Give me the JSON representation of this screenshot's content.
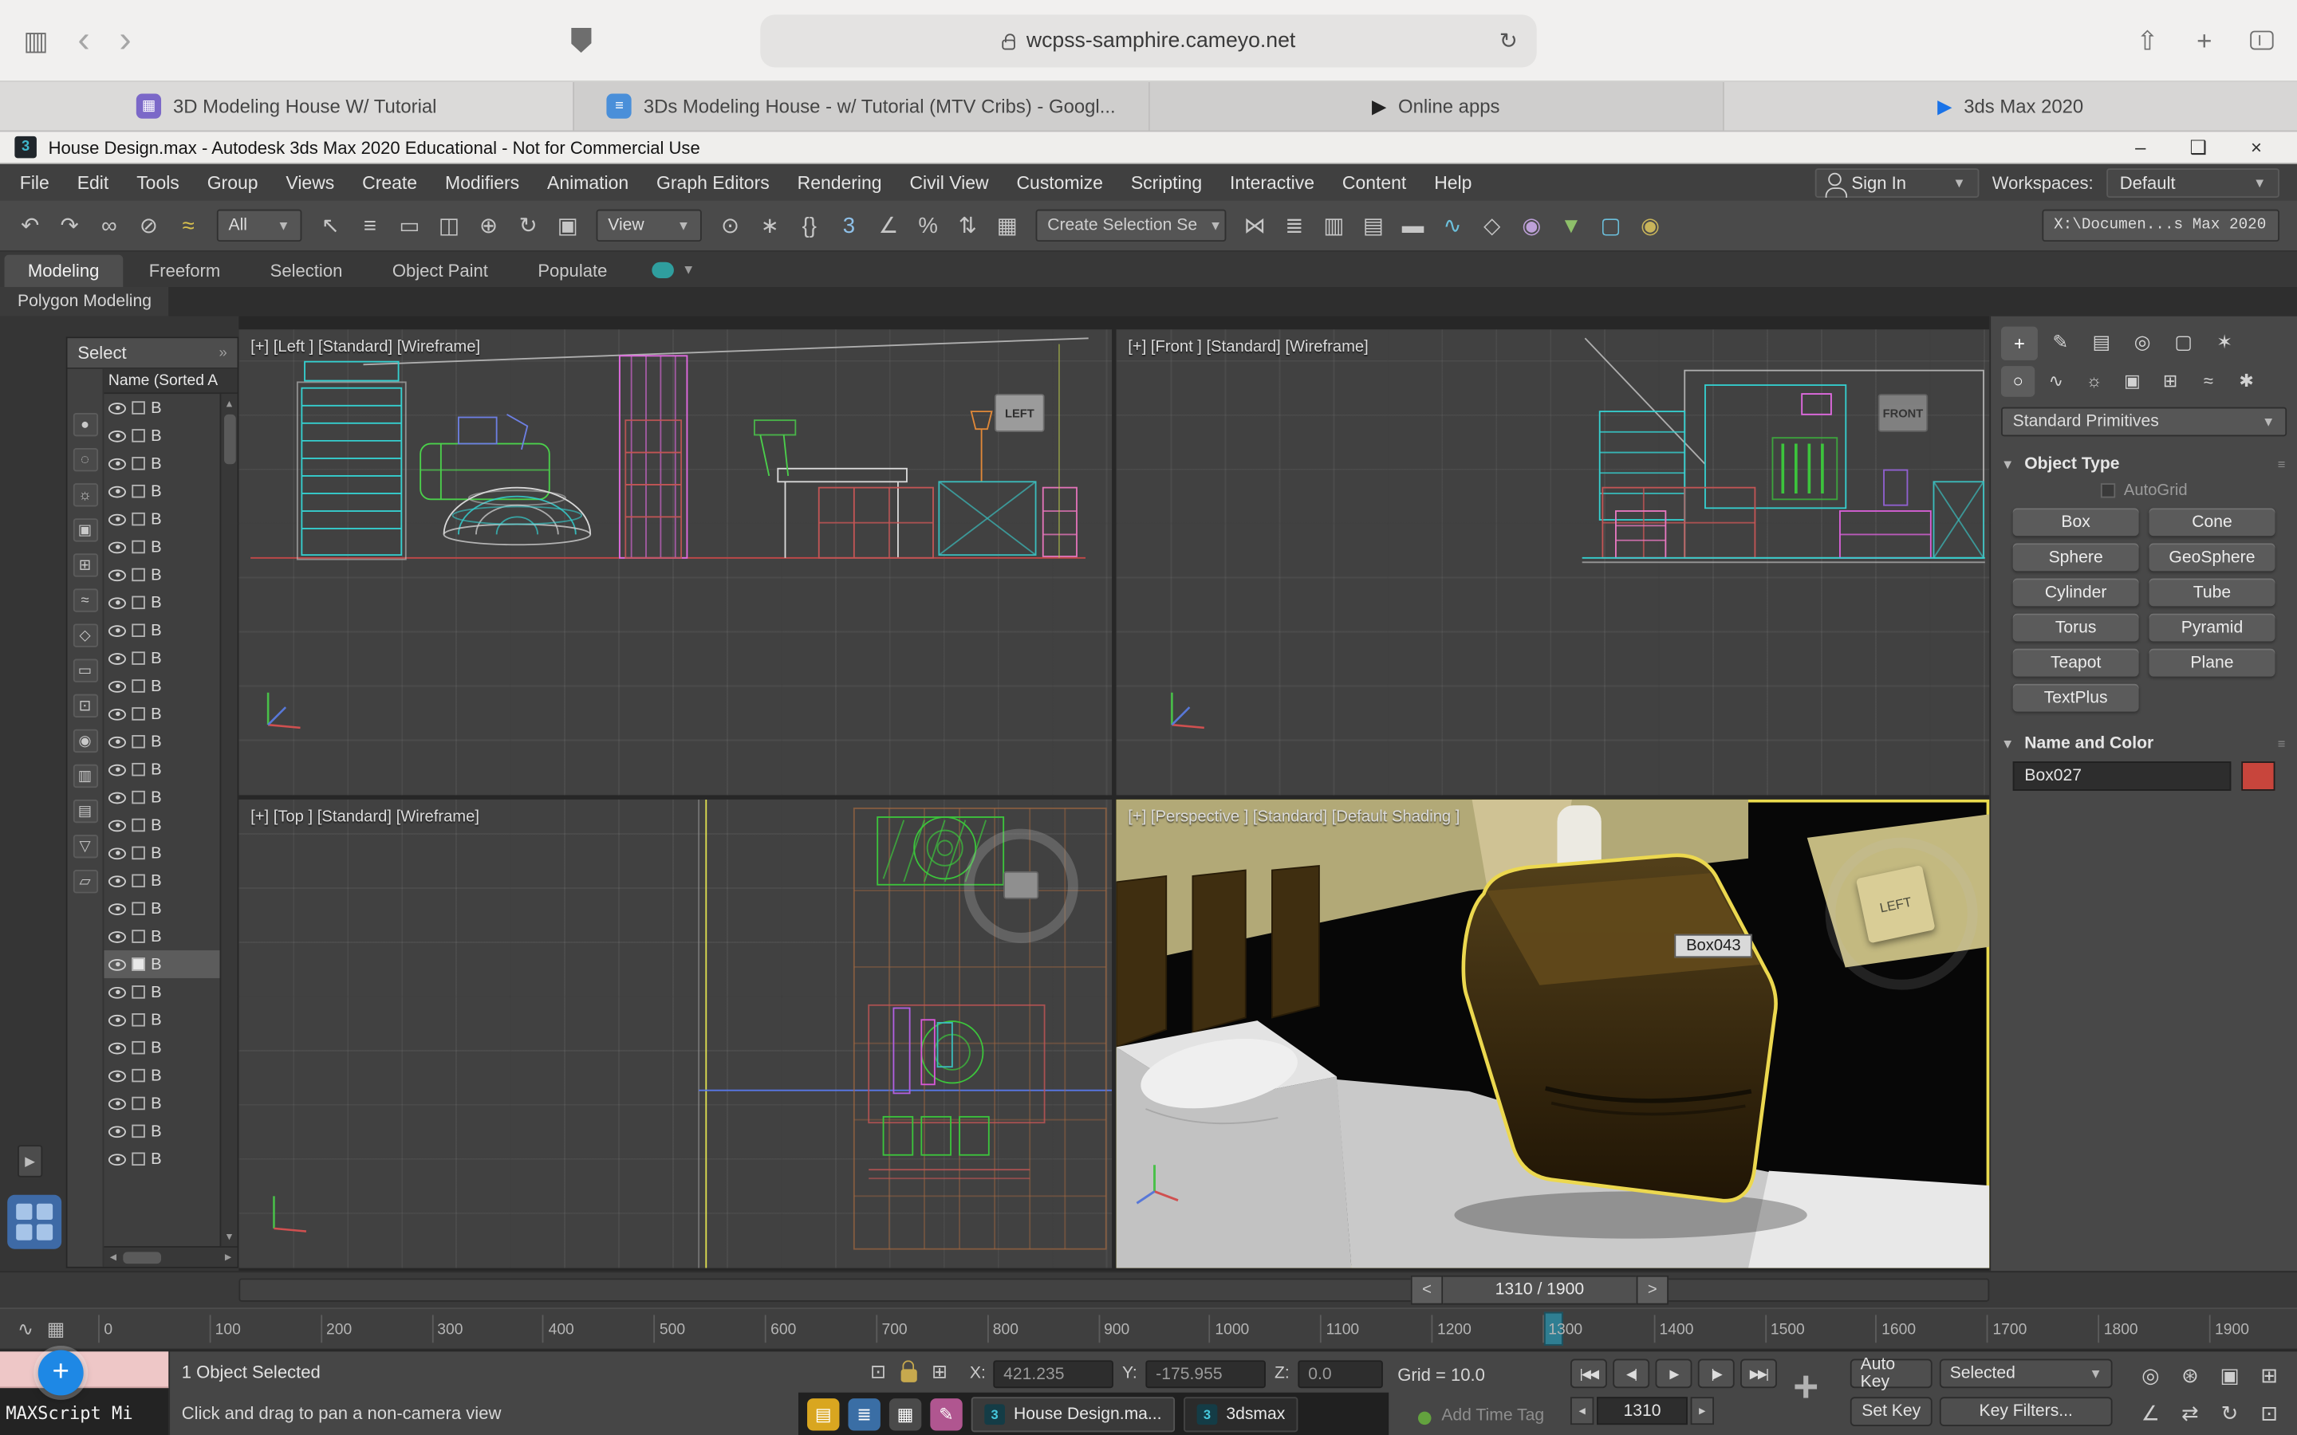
{
  "browser": {
    "url": "wcpss-samphire.cameyo.net",
    "tabs": [
      {
        "label": "3D Modeling House W/ Tutorial"
      },
      {
        "label": "3Ds Modeling House - w/ Tutorial (MTV Cribs) - Googl..."
      },
      {
        "label": "Online apps"
      },
      {
        "label": "3ds Max 2020"
      }
    ]
  },
  "window": {
    "title": "House Design.max - Autodesk 3ds Max 2020 Educational - Not for Commercial Use"
  },
  "menu": {
    "items": [
      "File",
      "Edit",
      "Tools",
      "Group",
      "Views",
      "Create",
      "Modifiers",
      "Animation",
      "Graph Editors",
      "Rendering",
      "Civil View",
      "Customize",
      "Scripting",
      "Interactive",
      "Content",
      "Help"
    ],
    "sign_in": "Sign In",
    "workspaces_label": "Workspaces:",
    "workspace_value": "Default"
  },
  "toolbar": {
    "selection_filter": "All",
    "coord_system": "View",
    "named_selection": "Create Selection Se",
    "project_path": "X:\\Documen...s Max 2020",
    "run1": [
      {
        "name": "undo-icon",
        "glyph": "↶"
      },
      {
        "name": "redo-icon",
        "glyph": "↷"
      },
      {
        "name": "select-and-link-icon",
        "glyph": "∞"
      },
      {
        "name": "unlink-selection-icon",
        "glyph": "⊘"
      },
      {
        "name": "bind-to-space-warp-icon",
        "glyph": "≈",
        "color": "#d8c04e"
      }
    ],
    "run2": [
      {
        "name": "select-object-icon",
        "glyph": "↖"
      },
      {
        "name": "select-by-name-icon",
        "glyph": "≡"
      },
      {
        "name": "rectangular-selection-icon",
        "glyph": "▭"
      },
      {
        "name": "window-crossing-icon",
        "glyph": "◫"
      },
      {
        "name": "select-and-move-icon",
        "glyph": "⊕"
      },
      {
        "name": "select-and-rotate-icon",
        "glyph": "↻"
      },
      {
        "name": "select-and-scale-icon",
        "glyph": "▣"
      }
    ],
    "run3": [
      {
        "name": "use-pivot-point-icon",
        "glyph": "⊙"
      },
      {
        "name": "select-and-manipulate-icon",
        "glyph": "∗"
      },
      {
        "name": "keyboard-shortcut-override-icon",
        "glyph": "{}"
      },
      {
        "name": "snaps-toggle-icon",
        "glyph": "3",
        "color": "#8ec0e8"
      },
      {
        "name": "angle-snap-icon",
        "glyph": "∠"
      },
      {
        "name": "percent-snap-icon",
        "glyph": "%"
      },
      {
        "name": "spinner-snap-icon",
        "glyph": "⇅"
      },
      {
        "name": "named-selection-sets-icon",
        "glyph": "▦"
      }
    ],
    "run4": [
      {
        "name": "mirror-icon",
        "glyph": "⋈"
      },
      {
        "name": "align-icon",
        "glyph": "≣"
      },
      {
        "name": "scene-explorer-toggle-icon",
        "glyph": "▥"
      },
      {
        "name": "layer-explorer-toggle-icon",
        "glyph": "▤"
      },
      {
        "name": "ribbon-toggle-icon",
        "glyph": "▬"
      },
      {
        "name": "curve-editor-icon",
        "glyph": "∿",
        "color": "#6cc0dc"
      },
      {
        "name": "schematic-view-icon",
        "glyph": "◇"
      },
      {
        "name": "material-editor-icon",
        "glyph": "◉",
        "color": "#bda0d8"
      },
      {
        "name": "render-setup-icon",
        "glyph": "▼",
        "color": "#8ec06a"
      },
      {
        "name": "rendered-frame-icon",
        "glyph": "▢",
        "color": "#6cc0dc"
      },
      {
        "name": "render-production-icon",
        "glyph": "◉",
        "color": "#c8b45a"
      }
    ]
  },
  "ribbon": {
    "tabs": [
      {
        "label": "Modeling",
        "active": true
      },
      {
        "label": "Freeform"
      },
      {
        "label": "Selection"
      },
      {
        "label": "Object Paint"
      },
      {
        "label": "Populate"
      }
    ],
    "panel": "Polygon Modeling"
  },
  "scene_explorer": {
    "title": "Select",
    "column_header": "Name (Sorted A",
    "filters": [
      {
        "name": "filter-all-icon",
        "glyph": "●"
      },
      {
        "name": "filter-geometry-icon",
        "glyph": "◌"
      },
      {
        "name": "filter-lights-icon",
        "glyph": "☼"
      },
      {
        "name": "filter-cameras-icon",
        "glyph": "▣"
      },
      {
        "name": "filter-helpers-icon",
        "glyph": "⊞"
      },
      {
        "name": "filter-space-warps-icon",
        "glyph": "≈"
      },
      {
        "name": "filter-shapes-icon",
        "glyph": "◇"
      },
      {
        "name": "filter-bones-icon",
        "glyph": "▭"
      },
      {
        "name": "filter-containers-icon",
        "glyph": "⊡"
      },
      {
        "name": "display-visibility-icon",
        "glyph": "◉"
      },
      {
        "name": "filter-layers-icon",
        "glyph": "▥"
      },
      {
        "name": "filter-materials-icon",
        "glyph": "▤"
      },
      {
        "name": "advanced-filter-icon",
        "glyph": "▽"
      },
      {
        "name": "container-icon",
        "glyph": "▱"
      }
    ],
    "rows": [
      {
        "label": "B"
      },
      {
        "label": "B"
      },
      {
        "label": "B"
      },
      {
        "label": "B"
      },
      {
        "label": "B"
      },
      {
        "label": "B"
      },
      {
        "label": "B"
      },
      {
        "label": "B"
      },
      {
        "label": "B"
      },
      {
        "label": "B"
      },
      {
        "label": "B"
      },
      {
        "label": "B"
      },
      {
        "label": "B"
      },
      {
        "label": "B"
      },
      {
        "label": "B"
      },
      {
        "label": "B"
      },
      {
        "label": "B"
      },
      {
        "label": "B"
      },
      {
        "label": "B"
      },
      {
        "label": "B"
      },
      {
        "label": "B",
        "selected": true
      },
      {
        "label": "B"
      },
      {
        "label": "B"
      },
      {
        "label": "B"
      },
      {
        "label": "B"
      },
      {
        "label": "B"
      },
      {
        "label": "B"
      },
      {
        "label": "B"
      }
    ]
  },
  "viewports": {
    "left": {
      "label": "[+] [Left ] [Standard] [Wireframe]",
      "viewcube": "LEFT"
    },
    "front": {
      "label": "[+] [Front ] [Standard] [Wireframe]",
      "viewcube": "FRONT"
    },
    "top": {
      "label": "[+] [Top ] [Standard] [Wireframe]"
    },
    "perspective": {
      "label": "[+] [Perspective ] [Standard] [Default Shading ]",
      "tooltip": "Box043",
      "note": "LEFT"
    }
  },
  "command_panel": {
    "tabs": [
      {
        "name": "create-tab-icon",
        "glyph": "+",
        "active": true
      },
      {
        "name": "modify-tab-icon",
        "glyph": "✎"
      },
      {
        "name": "hierarchy-tab-icon",
        "glyph": "▤"
      },
      {
        "name": "motion-tab-icon",
        "glyph": "◎"
      },
      {
        "name": "display-tab-icon",
        "glyph": "▢"
      },
      {
        "name": "utilities-tab-icon",
        "glyph": "✶"
      }
    ],
    "subtabs": [
      {
        "name": "geometry-category-icon",
        "glyph": "○",
        "active": true
      },
      {
        "name": "shapes-category-icon",
        "glyph": "∿"
      },
      {
        "name": "lights-category-icon",
        "glyph": "☼"
      },
      {
        "name": "cameras-category-icon",
        "glyph": "▣"
      },
      {
        "name": "helpers-category-icon",
        "glyph": "⊞"
      },
      {
        "name": "space-warps-category-icon",
        "glyph": "≈"
      },
      {
        "name": "systems-category-icon",
        "glyph": "✱"
      }
    ],
    "category_dropdown": "Standard Primitives",
    "object_type": {
      "title": "Object Type",
      "autogrid": "AutoGrid",
      "buttons": [
        "Box",
        "Cone",
        "Sphere",
        "GeoSphere",
        "Cylinder",
        "Tube",
        "Torus",
        "Pyramid",
        "Teapot",
        "Plane",
        "TextPlus"
      ]
    },
    "name_and_color": {
      "title": "Name and Color",
      "value": "Box027",
      "swatch_color": "#c8453c"
    }
  },
  "time": {
    "frame_display": "1310 / 1900",
    "frame_field": "1310",
    "ticks": [
      "0",
      "100",
      "200",
      "300",
      "400",
      "500",
      "600",
      "700",
      "800",
      "900",
      "1000",
      "1100",
      "1200",
      "1300",
      "1400",
      "1500",
      "1600",
      "1700",
      "1800",
      "1900"
    ]
  },
  "status_bar": {
    "maxscript": "MAXScript Mi",
    "selection_status": "1 Object Selected",
    "prompt": "Click and drag to pan a non-camera view",
    "x_label": "X:",
    "x": "421.235",
    "y_label": "Y:",
    "y": "-175.955",
    "z_label": "Z:",
    "z": "0.0",
    "grid": "Grid = 10.0",
    "auto_key": "Auto Key",
    "set_key": "Set Key",
    "selected_dropdown": "Selected",
    "key_filters": "Key Filters...",
    "add_time_tag": "Add Time Tag",
    "playback": [
      {
        "name": "go-to-start-icon",
        "glyph": "|◀◀"
      },
      {
        "name": "previous-frame-icon",
        "glyph": "◀|"
      },
      {
        "name": "play-icon",
        "glyph": "▶"
      },
      {
        "name": "next-frame-icon",
        "glyph": "|▶"
      },
      {
        "name": "go-to-end-icon",
        "glyph": "▶▶|"
      }
    ],
    "nav": [
      {
        "name": "zoom-icon",
        "glyph": "◎"
      },
      {
        "name": "zoom-all-icon",
        "glyph": "⊛"
      },
      {
        "name": "zoom-extents-icon",
        "glyph": "▣"
      },
      {
        "name": "zoom-extents-all-icon",
        "glyph": "⊞"
      },
      {
        "name": "field-of-view-icon",
        "glyph": "∠"
      },
      {
        "name": "pan-icon",
        "glyph": "⇄"
      },
      {
        "name": "orbit-icon",
        "glyph": "↻"
      },
      {
        "name": "maximize-viewport-icon",
        "glyph": "⊡"
      }
    ]
  },
  "taskbar": {
    "launchers": [
      {
        "name": "file-explorer-icon",
        "glyph": "▤",
        "bg": "#d9a620"
      },
      {
        "name": "library-icon",
        "glyph": "≣",
        "bg": "#3a6ea5"
      },
      {
        "name": "calculator-icon",
        "glyph": "▦",
        "bg": "#4a4a4a"
      },
      {
        "name": "paint-icon",
        "glyph": "✎",
        "bg": "#b05690"
      }
    ],
    "buttons": [
      {
        "label": "House Design.ma...",
        "active": true
      },
      {
        "label": "3dsmax",
        "active": false
      }
    ]
  },
  "fab": {
    "glyph": "+"
  }
}
